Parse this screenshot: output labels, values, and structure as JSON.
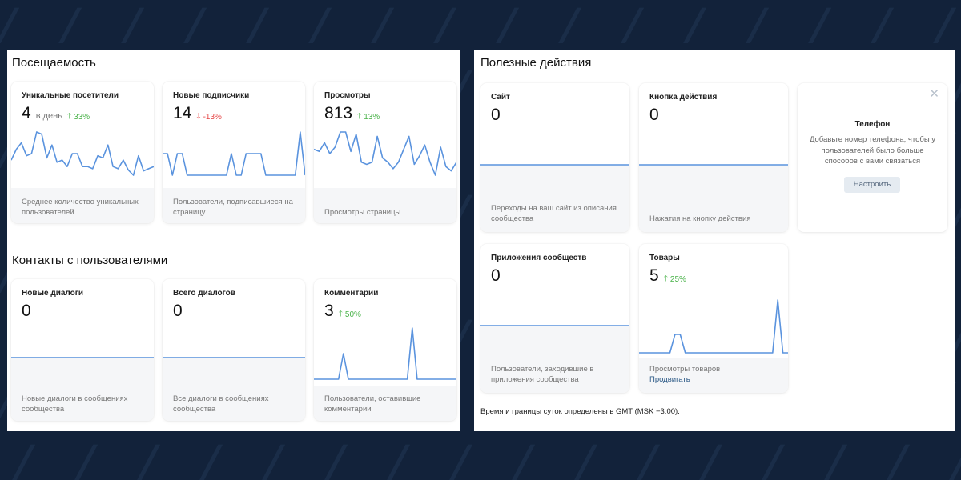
{
  "visits": {
    "title": "Посещаемость",
    "cards": [
      {
        "title": "Уникальные посетители",
        "value": "4",
        "suffix": "в день",
        "delta": "33%",
        "delta_dir": "up",
        "desc": "Среднее количество уникальных пользователей",
        "series": [
          0.35,
          0.6,
          0.75,
          0.45,
          0.5,
          1.0,
          0.95,
          0.4,
          0.7,
          0.3,
          0.35,
          0.2,
          0.5,
          0.5,
          0.2,
          0.2,
          0.15,
          0.45,
          0.4,
          0.7,
          0.2,
          0.15,
          0.35,
          0.12,
          0.0,
          0.45,
          0.1,
          0.15,
          0.2
        ]
      },
      {
        "title": "Новые подписчики",
        "value": "14",
        "suffix": "",
        "delta": "-13%",
        "delta_dir": "down",
        "desc": "Пользователи, подписавшиеся на страницу",
        "series": [
          0.5,
          0.5,
          0.0,
          0.5,
          0.5,
          0.0,
          0.0,
          0.0,
          0.0,
          0.0,
          0.0,
          0.0,
          0.0,
          0.0,
          0.5,
          0.0,
          0.0,
          0.5,
          0.5,
          0.5,
          0.5,
          0.0,
          0.0,
          0.0,
          0.0,
          0.0,
          0.0,
          0.0,
          1.0,
          0.0
        ]
      },
      {
        "title": "Просмотры",
        "value": "813",
        "suffix": "",
        "delta": "13%",
        "delta_dir": "up",
        "desc": "Просмотры страницы",
        "series": [
          0.6,
          0.55,
          0.75,
          0.5,
          0.65,
          1.0,
          1.0,
          0.55,
          0.95,
          0.3,
          0.25,
          0.3,
          0.9,
          0.4,
          0.3,
          0.15,
          0.3,
          0.6,
          0.9,
          0.25,
          0.45,
          0.7,
          0.3,
          0.0,
          0.65,
          0.2,
          0.1,
          0.3
        ]
      }
    ]
  },
  "contacts": {
    "title": "Контакты с пользователями",
    "cards": [
      {
        "title": "Новые диалоги",
        "value": "0",
        "suffix": "",
        "delta": "",
        "delta_dir": "",
        "desc": "Новые диалоги в сообщениях сообщества",
        "series": [
          0,
          0,
          0,
          0,
          0,
          0,
          0,
          0,
          0,
          0
        ]
      },
      {
        "title": "Всего диалогов",
        "value": "0",
        "suffix": "",
        "delta": "",
        "delta_dir": "",
        "desc": "Все диалоги в сообщениях сообщества",
        "series": [
          0,
          0,
          0,
          0,
          0,
          0,
          0,
          0,
          0,
          0
        ]
      },
      {
        "title": "Комментарии",
        "value": "3",
        "suffix": "",
        "delta": "50%",
        "delta_dir": "up",
        "desc": "Пользователи, оставившие комментарии",
        "series": [
          0,
          0,
          0,
          0,
          0,
          0,
          0.5,
          0,
          0,
          0,
          0,
          0,
          0,
          0,
          0,
          0,
          0,
          0,
          0,
          0,
          1.0,
          0,
          0,
          0,
          0,
          0,
          0,
          0,
          0,
          0
        ]
      }
    ]
  },
  "actions": {
    "title": "Полезные действия",
    "cards": [
      {
        "title": "Сайт",
        "value": "0",
        "suffix": "",
        "delta": "",
        "delta_dir": "",
        "desc": "Переходы на ваш сайт из описания сообщества",
        "link": "",
        "series": [
          0,
          0,
          0,
          0,
          0,
          0,
          0,
          0,
          0,
          0
        ]
      },
      {
        "title": "Кнопка действия",
        "value": "0",
        "suffix": "",
        "delta": "",
        "delta_dir": "",
        "desc": "Нажатия на кнопку действия",
        "link": "",
        "series": [
          0,
          0,
          0,
          0,
          0,
          0,
          0,
          0,
          0,
          0
        ]
      },
      {
        "title": "Приложения сообществ",
        "value": "0",
        "suffix": "",
        "delta": "",
        "delta_dir": "",
        "desc": "Пользователи, заходившие в приложения сообщества",
        "link": "",
        "series": [
          0,
          0,
          0,
          0,
          0,
          0,
          0,
          0,
          0,
          0
        ]
      },
      {
        "title": "Товары",
        "value": "5",
        "suffix": "",
        "delta": "25%",
        "delta_dir": "up",
        "desc": "Просмотры товаров",
        "link": "Продвигать",
        "series": [
          0,
          0,
          0,
          0,
          0,
          0,
          0,
          0.35,
          0.35,
          0,
          0,
          0,
          0,
          0,
          0,
          0,
          0,
          0,
          0,
          0,
          0,
          0,
          0,
          0,
          0,
          0,
          0,
          1.0,
          0,
          0
        ]
      }
    ],
    "phone": {
      "title": "Телефон",
      "desc": "Добавьте номер телефона, чтобы у пользователей было больше способов с вами связаться",
      "button": "Настроить"
    },
    "footnote": "Время и границы суток определены в GMT (MSK −3:00)."
  },
  "colors": {
    "line": "#5a93de",
    "background": "#12223a"
  }
}
